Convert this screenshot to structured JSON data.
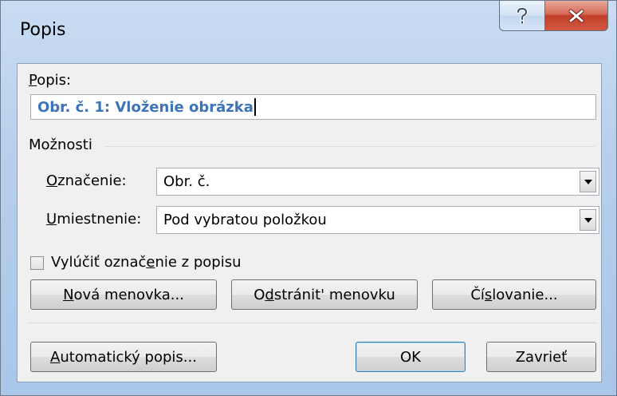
{
  "window": {
    "title": "Popis",
    "help_icon": "question-mark",
    "close_icon": "x"
  },
  "caption": {
    "label": {
      "ak": "P",
      "rest": "opis:"
    },
    "value": "Obr. č. 1: Vloženie obrázka"
  },
  "options": {
    "group_label": "Možnosti",
    "label_field": {
      "label": {
        "ak": "O",
        "rest": "značenie:"
      },
      "value": "Obr. č."
    },
    "position_field": {
      "label": {
        "ak": "U",
        "rest": "miestnenie:"
      },
      "value": "Pod vybratou položkou"
    },
    "exclude_checkbox": {
      "label": {
        "pre": "Vylúčiť označ",
        "ak": "e",
        "post": "nie z popisu"
      },
      "checked": false
    }
  },
  "buttons": {
    "new_label": {
      "ak": "N",
      "rest": "ová menovka..."
    },
    "delete_label": {
      "pre": "O",
      "ak": "d",
      "post": "stránit' menovku"
    },
    "numbering": {
      "pre": "Čí",
      "ak": "s",
      "post": "lovanie..."
    },
    "autocaption": {
      "ak": "A",
      "rest": "utomatický popis..."
    },
    "ok": "OK",
    "cancel": "Zavrieť"
  },
  "colors": {
    "caption_text": "#3d73b8",
    "close_button": "#c2402b",
    "default_button_border": "#3c7fb1"
  }
}
